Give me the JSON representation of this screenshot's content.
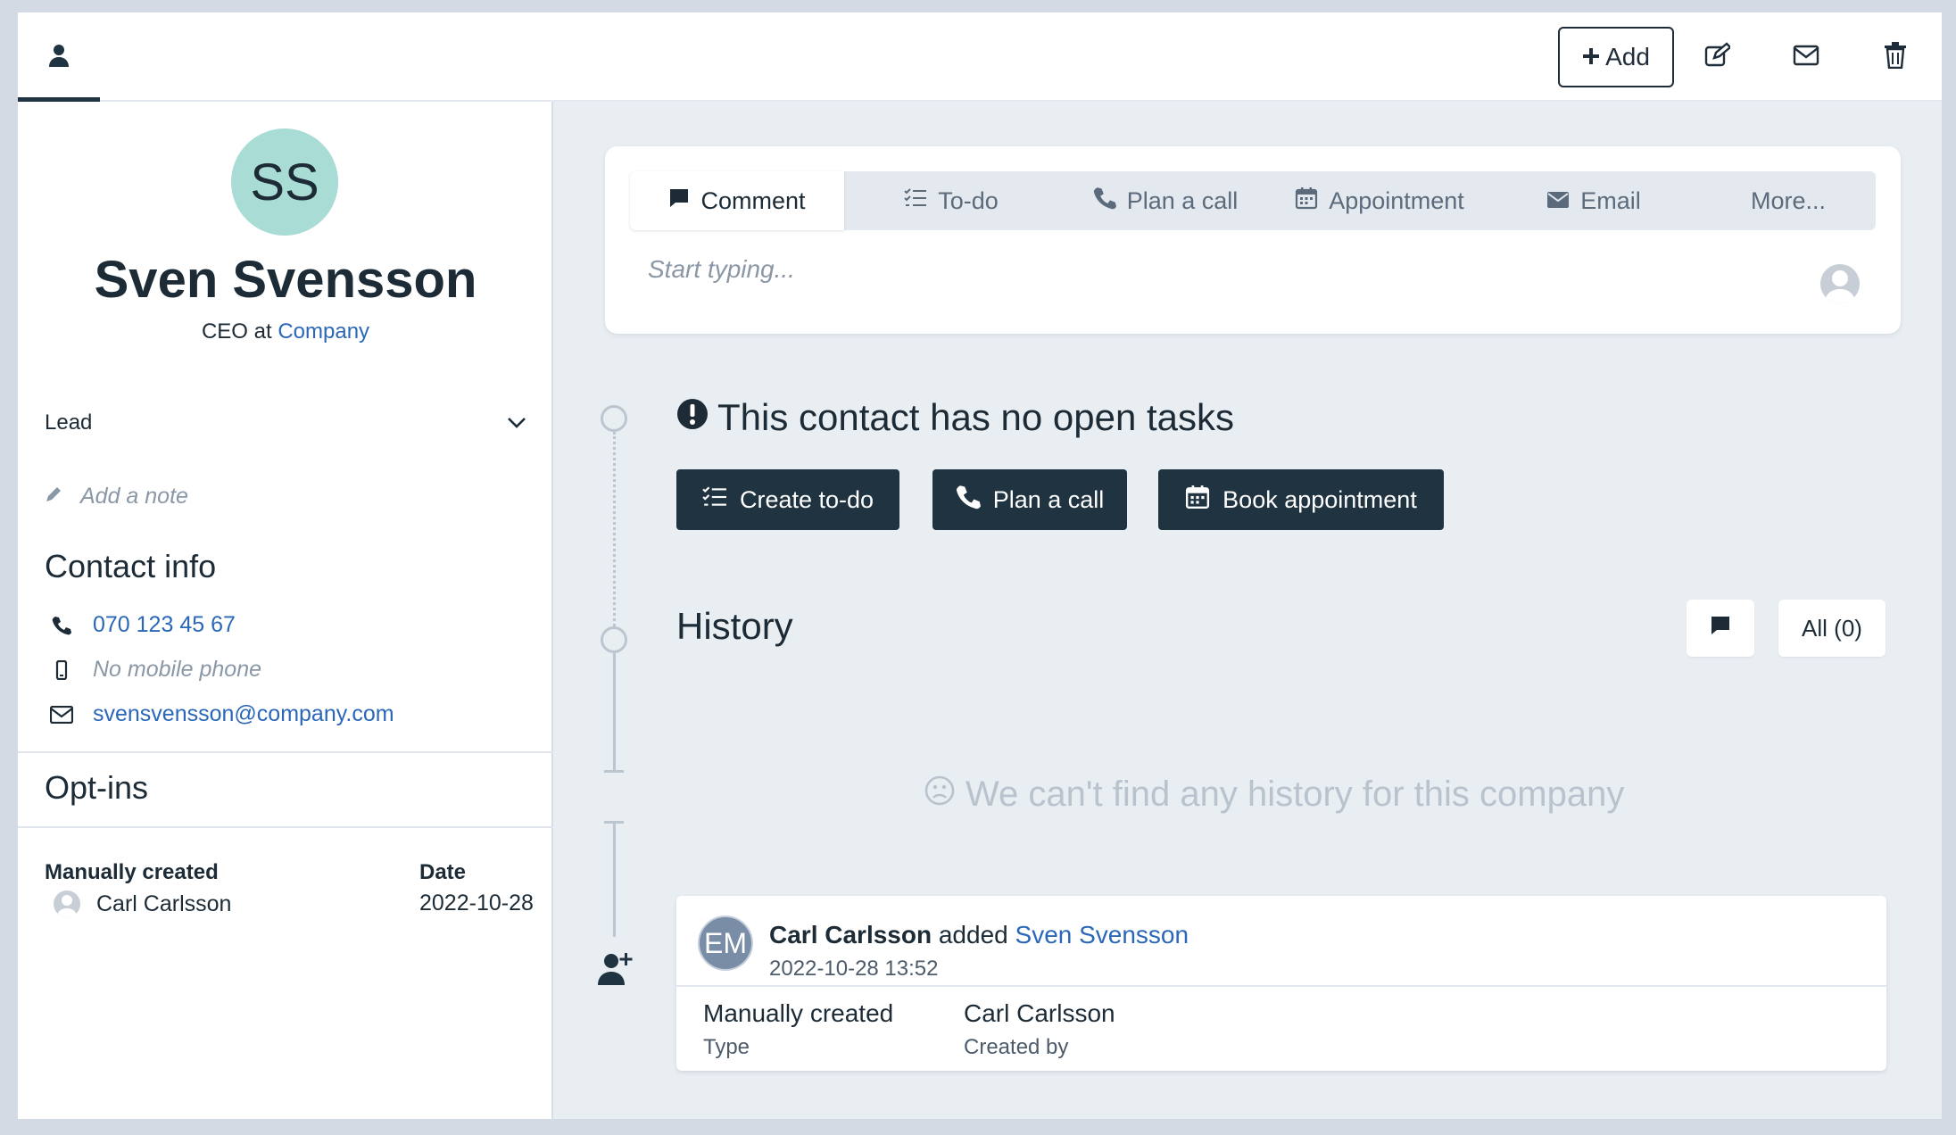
{
  "topbar": {
    "add_label": "Add",
    "icons": [
      "person-icon",
      "edit-icon",
      "mail-icon",
      "trash-icon"
    ]
  },
  "contact": {
    "initials": "SS",
    "name": "Sven Svensson",
    "role_prefix": "CEO at",
    "company": "Company",
    "status": "Lead",
    "add_note_placeholder": "Add a note",
    "contact_info_title": "Contact info",
    "phone": "070 123 45 67",
    "mobile": "No mobile phone",
    "email": "svensvensson@company.com"
  },
  "optins": {
    "title": "Opt-ins",
    "col1_header": "Manually created",
    "col1_value": "Carl Carlsson",
    "col2_header": "Date",
    "col2_value": "2022-10-28"
  },
  "composer": {
    "tabs": [
      {
        "label": "Comment",
        "icon": "comment-icon"
      },
      {
        "label": "To-do",
        "icon": "todo-list-icon"
      },
      {
        "label": "Plan a call",
        "icon": "phone-icon"
      },
      {
        "label": "Appointment",
        "icon": "calendar-icon"
      },
      {
        "label": "Email",
        "icon": "envelope-icon"
      },
      {
        "label": "More...",
        "icon": ""
      }
    ],
    "placeholder": "Start typing..."
  },
  "tasks": {
    "title": "This contact has no open tasks",
    "buttons": [
      "Create to-do",
      "Plan a call",
      "Book appointment"
    ]
  },
  "history": {
    "title": "History",
    "filter_all": "All (0)",
    "empty_message": "We can't find any history for this company",
    "entry": {
      "avatar_initials": "EM",
      "actor": "Carl Carlsson",
      "action": "added",
      "target": "Sven Svensson",
      "timestamp": "2022-10-28 13:52",
      "type_value": "Manually created",
      "type_label": "Type",
      "created_by_value": "Carl Carlsson",
      "created_by_label": "Created by"
    }
  },
  "colors": {
    "accent_dark": "#1f3340",
    "link": "#2b67b8",
    "avatar_bg": "#a9dcd5"
  }
}
